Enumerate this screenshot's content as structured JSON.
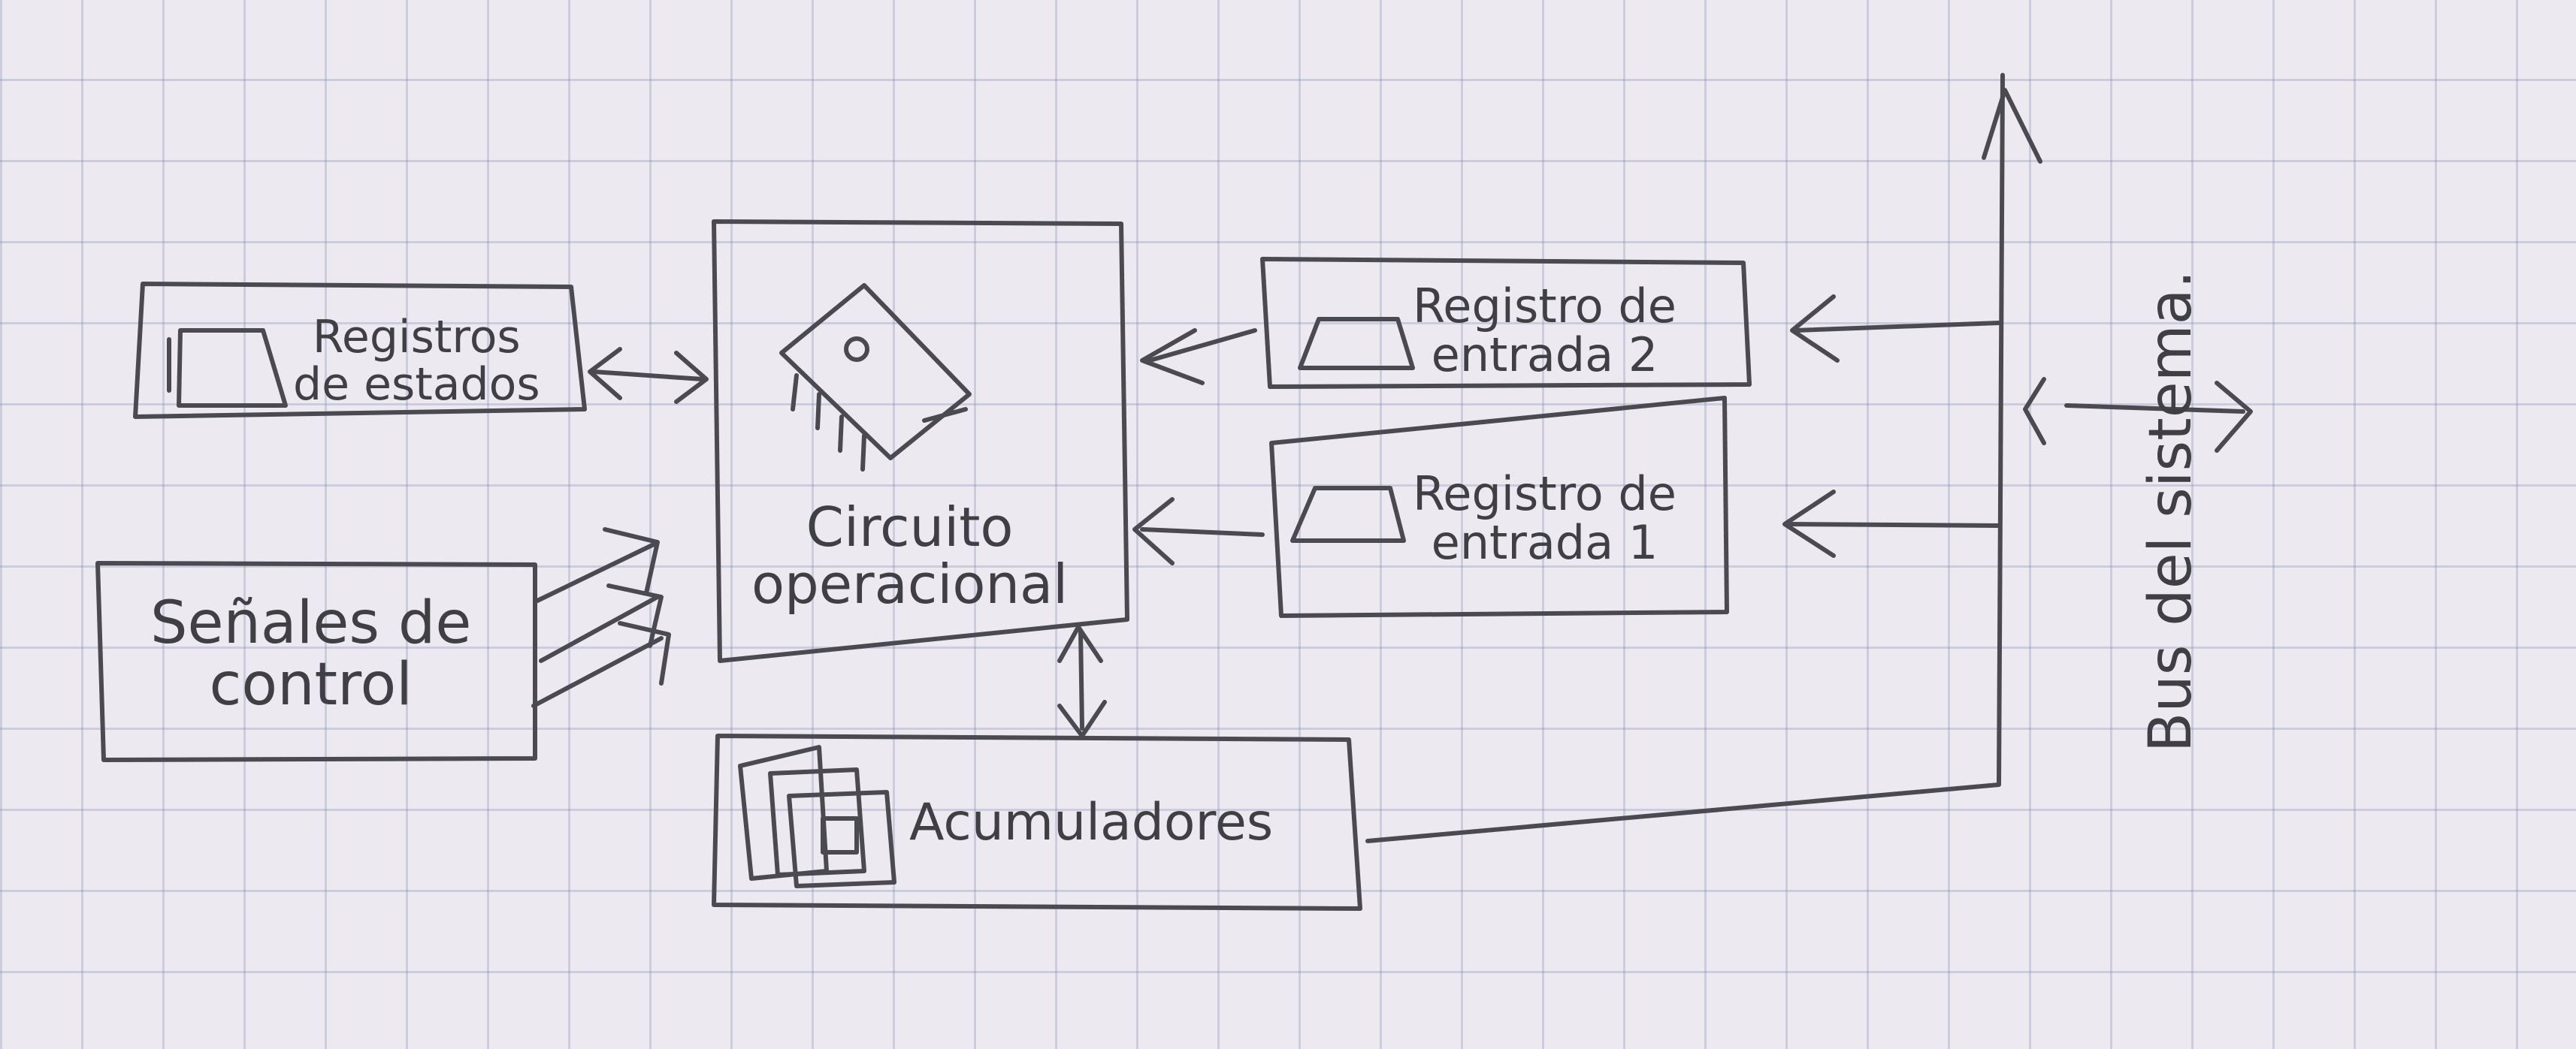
{
  "boxes": {
    "registros_estados": {
      "line1": "Registros",
      "line2": "de estados"
    },
    "senales_control": {
      "line1": "Señales de",
      "line2": "control"
    },
    "circuito_operacional": {
      "line1": "Circuito",
      "line2": "operacional"
    },
    "acumuladores": {
      "label": "Acumuladores"
    },
    "registro_entrada_2": {
      "line1": "Registro de",
      "line2": "entrada 2"
    },
    "registro_entrada_1": {
      "line1": "Registro de",
      "line2": "entrada 1"
    }
  },
  "bus": {
    "label": "Bus del sistema."
  },
  "colors": {
    "ink": "#4a4a50",
    "paper": "#eceaf0",
    "grid": "#7882aa"
  },
  "icons": [
    "register-icon",
    "chip-icon",
    "memory-chips-icon",
    "arrow-icon"
  ]
}
